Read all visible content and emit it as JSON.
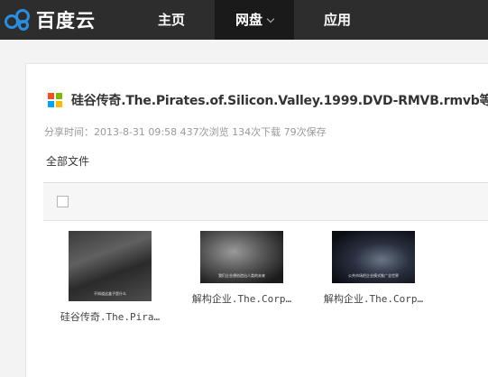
{
  "brand": {
    "name": "百度云",
    "logo_icon": "baidu-cloud-icon",
    "logo_color": "#2a8ee0"
  },
  "nav": {
    "items": [
      {
        "label": "主页"
      },
      {
        "label": "网盘",
        "active": true
      },
      {
        "label": "应用"
      }
    ]
  },
  "share": {
    "title": "硅谷传奇.The.Pirates.of.Silicon.Valley.1999.DVD-RMVB.rmvb等",
    "file_icon": "windows-logo-icon",
    "meta": "分享时间：2013-8-31 09:58 437次浏览 134次下载 79次保存",
    "breadcrumb": "全部文件"
  },
  "files": [
    {
      "name": "硅谷传奇.The.Pira…",
      "subtitle": "不知道这盒子是什么"
    },
    {
      "name": "解构企业.The.Corp…",
      "subtitle": "我们企业想创造出人类的未来"
    },
    {
      "name": "解构企业.The.Corp…",
      "subtitle": "公共市场把企业模式推广全世界"
    }
  ],
  "colors": {
    "topbar": "#2d2d2d",
    "ms_red": "#f25022",
    "ms_green": "#7fba00",
    "ms_blue": "#00a4ef",
    "ms_yellow": "#ffb900"
  }
}
